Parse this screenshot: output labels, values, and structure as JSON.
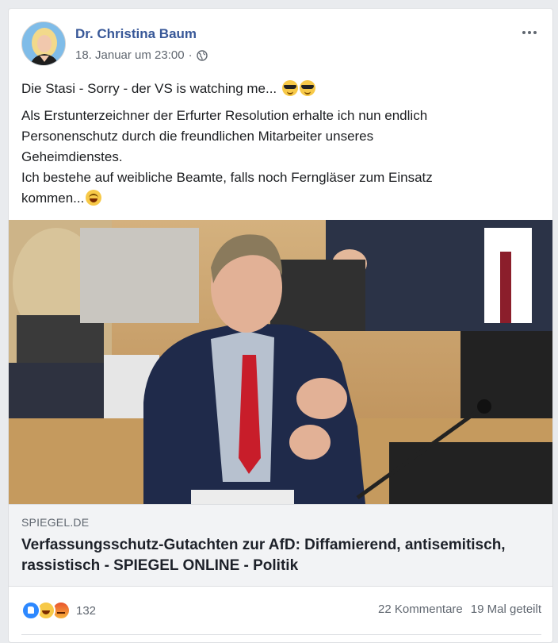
{
  "post": {
    "author": "Dr. Christina Baum",
    "timestamp": "18. Januar um 23:00",
    "separator": "·",
    "privacy_icon": "globe-icon",
    "more_icon": "more-options-icon",
    "text_line1": "Die Stasi - Sorry - der VS is watching me...",
    "text_line1_emojis": [
      "sunglasses-emoji",
      "sunglasses-emoji"
    ],
    "paragraph_lines": [
      "Als Erstunterzeichner der Erfurter Resolution erhalte ich nun endlich",
      "Personenschutz durch die freundlichen Mitarbeiter unseres",
      "Geheimdienstes.",
      "Ich bestehe auf weibliche Beamte, falls noch Ferngläser zum Einsatz",
      "kommen..."
    ],
    "last_line_emoji": "laughing-emoji"
  },
  "link_preview": {
    "domain": "SPIEGEL.DE",
    "headline": "Verfassungsschutz-Gutachten zur AfD: Diffamierend, antisemitisch, rassistisch - SPIEGEL ONLINE - Politik"
  },
  "footer": {
    "reaction_icons": [
      "like-icon",
      "haha-icon",
      "angry-icon"
    ],
    "reaction_count": "132",
    "comments": "22 Kommentare",
    "shares": "19 Mal geteilt"
  },
  "colors": {
    "author_link": "#385898",
    "background": "#e9ebee",
    "card": "#ffffff",
    "link_box": "#f2f3f5"
  }
}
